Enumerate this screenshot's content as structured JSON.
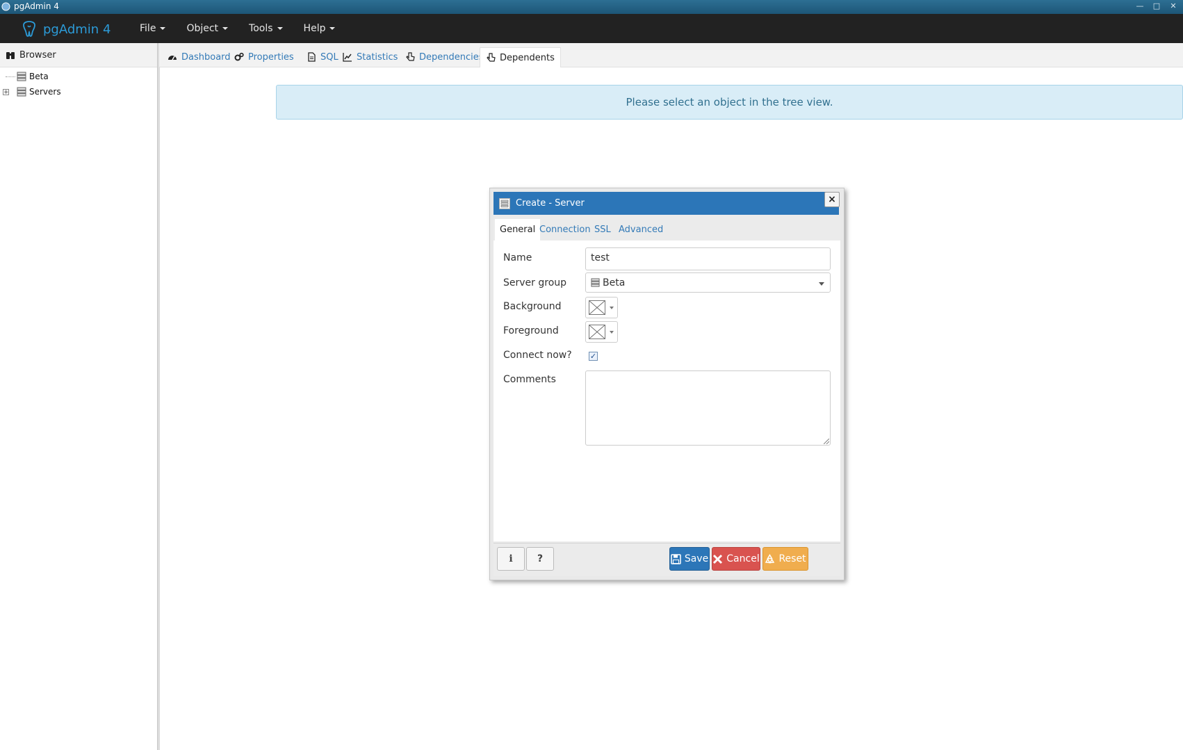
{
  "window": {
    "title": "pgAdmin 4"
  },
  "app": {
    "brand": "pgAdmin 4"
  },
  "menu": [
    "File",
    "Object",
    "Tools",
    "Help"
  ],
  "browser": {
    "title": "Browser",
    "nodes": [
      {
        "label": "Beta",
        "expandable": false
      },
      {
        "label": "Servers",
        "expandable": true
      }
    ]
  },
  "tabs": [
    {
      "label": "Dashboard",
      "icon": "dashboard-icon"
    },
    {
      "label": "Properties",
      "icon": "cogs-icon"
    },
    {
      "label": "SQL",
      "icon": "file-icon"
    },
    {
      "label": "Statistics",
      "icon": "line-chart-icon"
    },
    {
      "label": "Dependencies",
      "icon": "hand-icon"
    },
    {
      "label": "Dependents",
      "icon": "hand-icon",
      "active": true
    }
  ],
  "alert": {
    "text": "Please select an object in the tree view."
  },
  "dialog": {
    "title": "Create - Server",
    "close": "×",
    "tabs": [
      "General",
      "Connection",
      "SSL",
      "Advanced"
    ],
    "active_tab": "General",
    "fields": {
      "name_label": "Name",
      "name_value": "test",
      "server_group_label": "Server group",
      "server_group_value": "Beta",
      "background_label": "Background",
      "foreground_label": "Foreground",
      "connect_label": "Connect now?",
      "connect_checked": true,
      "comments_label": "Comments",
      "comments_value": ""
    },
    "footer": {
      "info": "i",
      "help": "?",
      "save": "Save",
      "cancel": "Cancel",
      "reset": "Reset"
    }
  },
  "colors": {
    "navbar": "#222222",
    "brand": "#2c9bd8",
    "dialog_header": "#2c76b8",
    "save": "#2c76b8",
    "cancel": "#d9534f",
    "reset": "#f0ad4e",
    "alert_bg": "#d9edf7"
  }
}
